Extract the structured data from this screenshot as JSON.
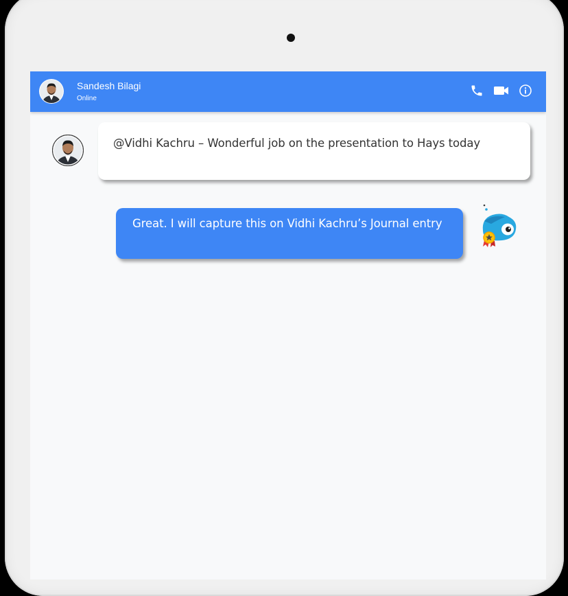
{
  "contact": {
    "name": "Sandesh Bilagi",
    "status": "Online"
  },
  "header_icons": [
    "phone-icon",
    "video-camera-icon",
    "info-icon"
  ],
  "messages": [
    {
      "from": "Sandesh Bilagi",
      "text": "@Vidhi Kachru – Wonderful job on the presentation to Hays today"
    },
    {
      "from": "bot",
      "text": "Great. I will capture this on Vidhi Kachru’s Journal entry"
    }
  ],
  "colors": {
    "accent": "#3e86f5",
    "incoming_bubble": "#ffffff",
    "outgoing_bubble": "#3e86f5",
    "background": "#f8f9fa"
  }
}
